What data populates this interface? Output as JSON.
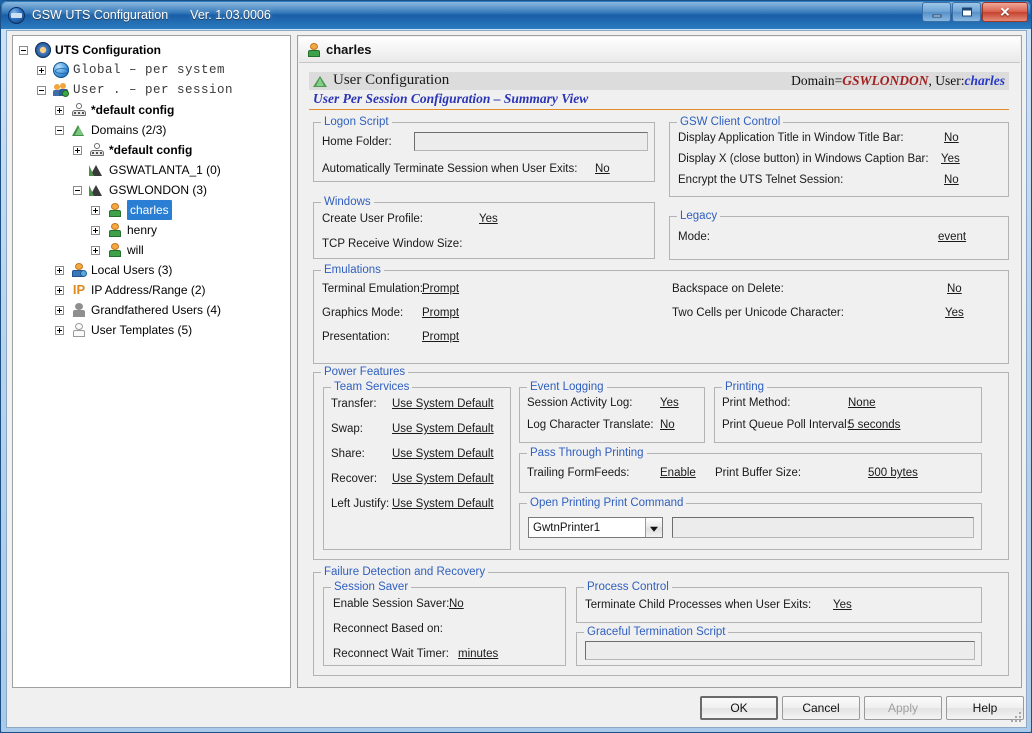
{
  "window": {
    "title": "GSW UTS Configuration",
    "version": "Ver. 1.03.0006",
    "logo_icon": "gsw-logo-icon",
    "minimize_label": "Minimize",
    "maximize_label": "Maximize",
    "close_label": "Close"
  },
  "tree": {
    "nodes": [
      {
        "label": "UTS Configuration",
        "icon": "gear-icon",
        "depth": 0,
        "expander": "minus",
        "style": "bold"
      },
      {
        "label": "Global  –  per system",
        "icon": "globe-icon",
        "depth": 1,
        "expander": "plus",
        "style": "mono"
      },
      {
        "label": "User  .   –  per session",
        "icon": "users-icon",
        "depth": 1,
        "expander": "minus",
        "style": "mono"
      },
      {
        "label": "*default config",
        "icon": "default-config-icon",
        "depth": 2,
        "expander": "plus",
        "style": "bold"
      },
      {
        "label": "Domains (2/3)",
        "icon": "green-triangle-icon",
        "depth": 2,
        "expander": "minus",
        "style": "normal"
      },
      {
        "label": "*default config",
        "icon": "default-config-icon",
        "depth": 3,
        "expander": "plus",
        "style": "bold"
      },
      {
        "label": "GSWATLANTA_1 (0)",
        "icon": "dark-triangle-icon",
        "depth": 3,
        "expander": "none",
        "style": "normal"
      },
      {
        "label": "GSWLONDON (3)",
        "icon": "dark-triangle-icon",
        "depth": 3,
        "expander": "minus",
        "style": "normal"
      },
      {
        "label": "charles",
        "icon": "user-icon",
        "depth": 4,
        "expander": "plus",
        "style": "selected"
      },
      {
        "label": "henry",
        "icon": "user-icon",
        "depth": 4,
        "expander": "plus",
        "style": "normal"
      },
      {
        "label": "will",
        "icon": "user-icon",
        "depth": 4,
        "expander": "plus",
        "style": "normal"
      },
      {
        "label": "Local Users (3)",
        "icon": "local-user-icon",
        "depth": 2,
        "expander": "plus",
        "style": "normal"
      },
      {
        "label": "IP Address/Range (2)",
        "icon": "ip-icon",
        "depth": 2,
        "expander": "plus",
        "style": "normal"
      },
      {
        "label": "Grandfathered Users (4)",
        "icon": "gray-user-icon",
        "depth": 2,
        "expander": "plus",
        "style": "normal"
      },
      {
        "label": "User Templates (5)",
        "icon": "template-user-icon",
        "depth": 2,
        "expander": "plus",
        "style": "normal"
      }
    ]
  },
  "panel": {
    "header_title": "charles",
    "header_icon": "user-icon",
    "section_title": "User Configuration",
    "section_icon": "green-triangle-icon",
    "domain_prefix": "Domain=",
    "domain_value": "GSWLONDON",
    "user_prefix": ", User:",
    "user_value": "charles",
    "subtitle": "User Per Session Configuration – Summary View"
  },
  "logon_script": {
    "legend": "Logon Script",
    "home_folder_label": "Home Folder:",
    "home_folder_value": "",
    "auto_terminate_label": "Automatically Terminate Session when User Exits:",
    "auto_terminate_value": "No"
  },
  "windows": {
    "legend": "Windows",
    "create_profile_label": "Create User Profile:",
    "create_profile_value": "Yes",
    "tcp_window_label": "TCP Receive Window Size:",
    "tcp_window_value": ""
  },
  "gsw_client_control": {
    "legend": "GSW Client Control",
    "rows": [
      {
        "label": "Display Application Title in Window Title Bar:",
        "value": "No"
      },
      {
        "label": "Display X (close button) in Windows Caption Bar:",
        "value": "Yes"
      },
      {
        "label": "Encrypt the UTS Telnet Session:",
        "value": "No"
      }
    ]
  },
  "legacy": {
    "legend": "Legacy",
    "mode_label": "Mode:",
    "mode_value": "event"
  },
  "emulations": {
    "legend": "Emulations",
    "left_rows": [
      {
        "label": "Terminal Emulation:",
        "value": "Prompt"
      },
      {
        "label": "Graphics Mode:",
        "value": "Prompt"
      },
      {
        "label": "Presentation:",
        "value": "Prompt"
      }
    ],
    "right_rows": [
      {
        "label": "Backspace on Delete:",
        "value": "No"
      },
      {
        "label": "Two Cells per Unicode Character:",
        "value": "Yes"
      }
    ]
  },
  "power_features": {
    "legend": "Power Features",
    "team_services": {
      "legend": "Team Services",
      "rows": [
        {
          "label": "Transfer:",
          "value": "Use System Default"
        },
        {
          "label": "Swap:",
          "value": "Use System Default"
        },
        {
          "label": "Share:",
          "value": "Use System Default"
        },
        {
          "label": "Recover:",
          "value": "Use System Default"
        },
        {
          "label": "Left Justify:",
          "value": "Use System Default"
        }
      ]
    },
    "event_logging": {
      "legend": "Event Logging",
      "rows": [
        {
          "label": "Session Activity Log:",
          "value": "Yes"
        },
        {
          "label": "Log Character Translate:",
          "value": "No"
        }
      ]
    },
    "printing": {
      "legend": "Printing",
      "rows": [
        {
          "label": "Print Method:",
          "value": "None"
        },
        {
          "label": "Print Queue Poll Interval:",
          "value": "5 seconds"
        }
      ]
    },
    "pass_through_printing": {
      "legend": "Pass Through Printing",
      "trailing_formfeeds_label": "Trailing FormFeeds:",
      "trailing_formfeeds_value": "Enable",
      "print_buffer_label": "Print Buffer Size:",
      "print_buffer_value": "500 bytes"
    },
    "open_printing": {
      "legend": "Open Printing Print Command",
      "printer_selected": "GwtnPrinter1",
      "command_value": ""
    }
  },
  "failure_detection": {
    "legend": "Failure Detection and Recovery",
    "session_saver": {
      "legend": "Session Saver",
      "enable_label": "Enable Session Saver:",
      "enable_value": "No",
      "reconnect_based_label": "Reconnect Based on:",
      "reconnect_based_value": "",
      "reconnect_timer_label": "Reconnect Wait Timer:",
      "reconnect_timer_value": "minutes"
    },
    "process_control": {
      "legend": "Process Control",
      "terminate_label": "Terminate Child Processes when User Exits:",
      "terminate_value": "Yes"
    },
    "graceful_termination": {
      "legend": "Graceful Termination Script",
      "value": ""
    }
  },
  "buttons": {
    "ok": "OK",
    "cancel": "Cancel",
    "apply": "Apply",
    "help": "Help"
  },
  "colors": {
    "accent_orange": "#e08a2a",
    "legend_blue": "#2f5fbf",
    "selection_blue": "#2a7fd4",
    "domain_red": "#a32020",
    "user_blue": "#2838c8"
  }
}
